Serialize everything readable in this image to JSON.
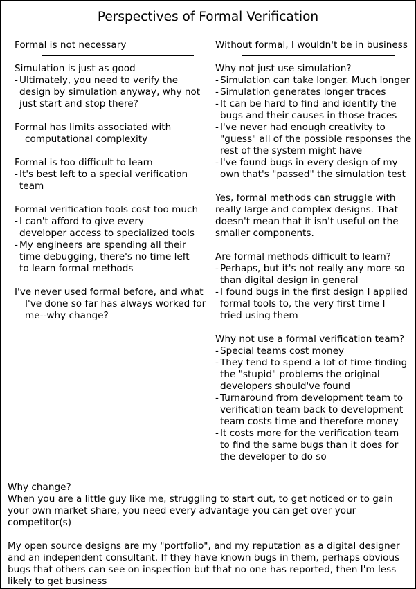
{
  "title": "Perspectives of Formal Verification",
  "left": {
    "heading": "Formal is not necessary",
    "blocks": [
      {
        "lead": "Simulation is just as good",
        "bullets": [
          [
            "Ultimately, you need to verify the",
            "design by simulation anyway, why not",
            "just start and stop there?"
          ]
        ]
      },
      {
        "lead_lines": [
          "Formal has limits associated with",
          "computational complexity"
        ]
      },
      {
        "lead": "Formal is too difficult to learn",
        "bullets": [
          [
            "It's best left to a special verification",
            "team"
          ]
        ]
      },
      {
        "lead": "Formal verification tools cost too much",
        "bullets": [
          [
            "I can't afford to give every",
            "developer access to specialized tools"
          ],
          [
            "My engineers are spending all their",
            "time debugging, there's no time left",
            "to learn formal methods"
          ]
        ]
      },
      {
        "lead_lines": [
          "I've never used formal before, and what",
          "I've done so far has always worked for",
          "me--why change?"
        ]
      }
    ]
  },
  "right": {
    "heading": "Without formal, I wouldn't be in business",
    "blocks": [
      {
        "lead": "Why not just use simulation?",
        "bullets": [
          [
            "Simulation can take longer.  Much longer"
          ],
          [
            "Simulation generates longer traces"
          ],
          [
            "It can be hard to find and identify the",
            "bugs and their causes in those traces"
          ],
          [
            "I've never had enough creativity to",
            "\"guess\" all of the possible responses the",
            "rest of the system might have"
          ],
          [
            "I've found bugs in every design of my",
            "own that's \"passed\" the simulation test"
          ]
        ]
      },
      {
        "lead_lines": [
          "Yes, formal methods can struggle with",
          "really large and complex designs.  That",
          "doesn't mean that it isn't useful on the",
          "smaller components."
        ]
      },
      {
        "lead": "Are formal methods difficult to learn?",
        "bullets": [
          [
            "Perhaps, but it's not really any more so",
            "than digital design in general"
          ],
          [
            "I found bugs in the first design I applied",
            "formal tools to, the very first time I",
            "tried using them"
          ]
        ]
      },
      {
        "lead": "Why not use a formal verification team?",
        "bullets": [
          [
            "Special teams cost money"
          ],
          [
            "They tend to spend a lot of time finding",
            "the \"stupid\" problems the original",
            "developers should've found"
          ],
          [
            "Turnaround from development team to",
            "verification team back to development",
            "team costs time and therefore money"
          ],
          [
            "It costs more for the verification team",
            "to find the same bugs than it does for",
            "the developer to do so"
          ]
        ]
      }
    ]
  },
  "bottom": {
    "heading": "Why change?",
    "paragraphs": [
      [
        "When you are a little guy like me, struggling to start out, to get noticed or to gain",
        "your own market share, you need every advantage you can get over your",
        "competitor(s)"
      ],
      [
        "My open source designs are my \"portfolio\", and my reputation as a digital designer",
        "and an independent consultant.  If they have known bugs in them, perhaps obvious",
        "bugs that others can see on inspection but that no one has reported, then I'm less",
        "likely to get business"
      ]
    ]
  }
}
